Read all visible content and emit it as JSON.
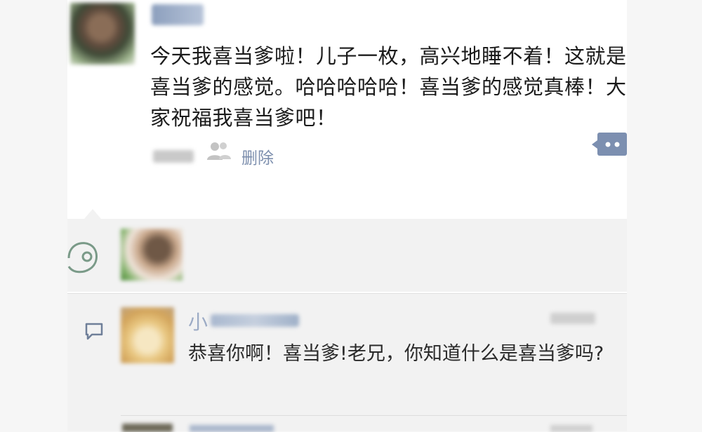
{
  "post": {
    "text": "今天我喜当爹啦！儿子一枚，高兴地睡不着！这就是喜当爹的感觉。哈哈哈哈哈！喜当爹的感觉真棒！大家祝福我喜当爹吧！",
    "delete_label": "删除"
  },
  "comment": {
    "author_first_char": "小",
    "text": "恭喜你啊！喜当爹!老兄，你知道什么是喜当爹吗?"
  },
  "icons": {
    "privacy": "people-icon",
    "comment_action": "comment-bubble-icon",
    "like": "like-heart-icon",
    "comment": "comment-icon"
  },
  "colors": {
    "link": "#7d8fae",
    "text": "#1b1b1b",
    "panel": "#f2f2f2"
  }
}
